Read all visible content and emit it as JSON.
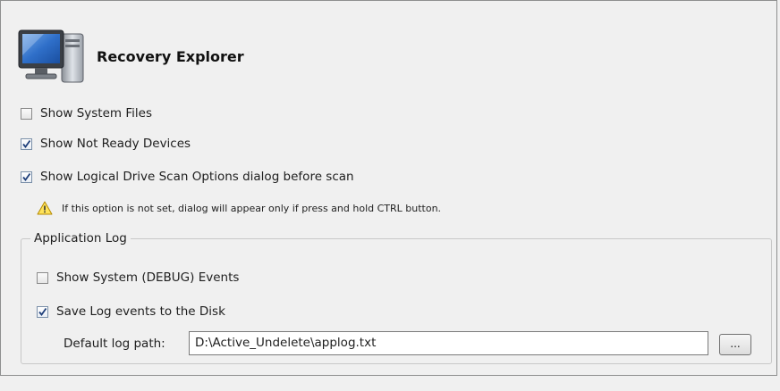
{
  "header": {
    "title": "Recovery Explorer",
    "icon": "computer-icon"
  },
  "options": [
    {
      "label": "Show System Files",
      "checked": false
    },
    {
      "label": "Show Not Ready Devices",
      "checked": true
    },
    {
      "label": "Show Logical Drive Scan Options dialog before scan",
      "checked": true
    }
  ],
  "warning": {
    "icon": "warning-icon",
    "text": "If this option is not set, dialog will appear only if press and hold CTRL button."
  },
  "app_log": {
    "legend": "Application Log",
    "options": [
      {
        "label": "Show System (DEBUG) Events",
        "checked": false
      },
      {
        "label": "Save Log events to the Disk",
        "checked": true
      }
    ],
    "path_label": "Default log path:",
    "path_value": "D:\\Active_Undelete\\applog.txt",
    "browse_label": "..."
  }
}
